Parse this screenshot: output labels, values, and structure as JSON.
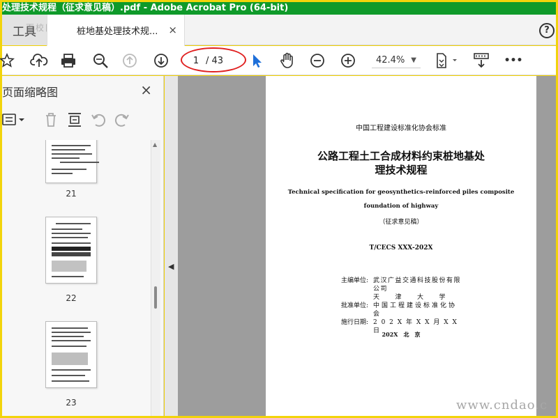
{
  "window": {
    "title": "处理技术规程（征求意见稿）.pdf - Adobe Acrobat Pro (64-bit)"
  },
  "tabs": {
    "tools_label": "工具",
    "doc_label": "桩地基处理技术规...",
    "close_glyph": "×",
    "help_glyph": "?"
  },
  "watermark_top": "百校网",
  "toolbar": {
    "current_page": "1",
    "total_pages": "/ 43",
    "zoom": "42.4%",
    "more_glyph": "•••",
    "icons": [
      "star-icon",
      "cloud-upload-icon",
      "print-icon",
      "zoom-search-icon",
      "page-up-icon",
      "page-down-icon",
      "select-cursor-icon",
      "hand-icon",
      "zoom-out-icon",
      "zoom-in-icon",
      "fit-page-icon",
      "scroll-mode-icon",
      "more-icon"
    ]
  },
  "sidebar": {
    "title": "页面缩略图",
    "close_glyph": "×",
    "thumbnails": [
      {
        "label": "21"
      },
      {
        "label": "22"
      },
      {
        "label": "23"
      }
    ]
  },
  "page": {
    "header": "中国工程建设标准化协会标准",
    "title_line1": "公路工程土工合成材料约束桩地基处",
    "title_line2": "理技术规程",
    "en_line1": "Technical specification for geosynthetics-reinforced piles composite",
    "en_line2": "foundation of highway",
    "draft": "（征求意见稿）",
    "code": "T/CECS XXX-202X",
    "units": [
      {
        "k": "主编单位:",
        "v": "武汉广益交通科技股份有限公司"
      },
      {
        "k": "",
        "v": "天　　津　　大　　学"
      },
      {
        "k": "批准单位:",
        "v": "中国工程建设标准化协会"
      },
      {
        "k": "施行日期:",
        "v": "2 0 2 X 年 X X 月 X X 日"
      }
    ],
    "footer": "202X　北　京"
  },
  "watermark_bottom": "www.cndao.c",
  "colors": {
    "titlebar": "#0f9a2a",
    "frame": "#f2d40b",
    "ellipse": "#e02020",
    "cursor": "#1e6fd9"
  }
}
